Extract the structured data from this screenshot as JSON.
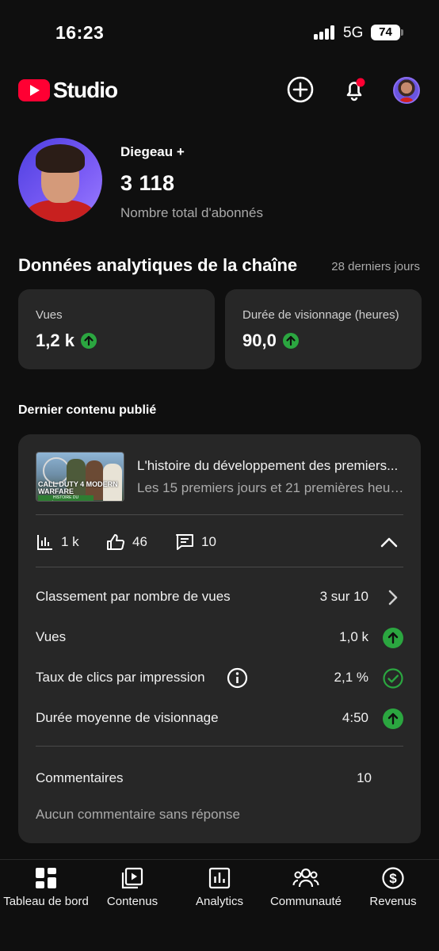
{
  "status_bar": {
    "time": "16:23",
    "network": "5G",
    "battery": "74"
  },
  "header": {
    "logo_text": "Studio",
    "icons": [
      "create-icon",
      "notifications-icon",
      "account-avatar"
    ]
  },
  "channel": {
    "name": "Diegeau +",
    "subscribers": "3 118",
    "subscribers_label": "Nombre total d'abonnés"
  },
  "analytics": {
    "title": "Données analytiques de la chaîne",
    "range": "28 derniers jours",
    "cards": [
      {
        "label": "Vues",
        "value": "1,2 k",
        "trend": "up"
      },
      {
        "label": "Durée de visionnage (heures)",
        "value": "90,0",
        "trend": "up"
      }
    ]
  },
  "latest": {
    "section_title": "Dernier contenu publié",
    "video": {
      "title": "L'histoire du développement des premiers...",
      "subtitle": "Les 15 premiers jours et 21 premières heures...",
      "thumb_logo": "CALL DUTY 4 MODERN WARFARE",
      "thumb_banner": "HISTOIRE DU DÉVELOPPEMENT"
    },
    "metrics": {
      "views": "1 k",
      "likes": "46",
      "comments": "10"
    },
    "rows": [
      {
        "label": "Classement par nombre de vues",
        "value": "3 sur 10",
        "icon": "chevron-right-icon"
      },
      {
        "label": "Vues",
        "value": "1,0 k",
        "icon": "trend-up-icon"
      },
      {
        "label": "Taux de clics par impression",
        "value": "2,1 %",
        "icon": "check-circle-icon"
      },
      {
        "label": "Durée moyenne de visionnage",
        "value": "4:50",
        "icon": "trend-up-icon"
      }
    ],
    "comments_label": "Commentaires",
    "comments_value": "10",
    "comments_empty": "Aucun commentaire sans réponse"
  },
  "colors": {
    "background": "#0f0f0f",
    "card": "#272727",
    "brand_red": "#ff0033",
    "success_green": "#2ba640"
  },
  "bottom_nav": [
    {
      "label": "Tableau de bord",
      "icon": "dashboard-icon"
    },
    {
      "label": "Contenus",
      "icon": "content-icon"
    },
    {
      "label": "Analytics",
      "icon": "analytics-icon"
    },
    {
      "label": "Communauté",
      "icon": "community-icon"
    },
    {
      "label": "Revenus",
      "icon": "revenue-icon"
    }
  ]
}
